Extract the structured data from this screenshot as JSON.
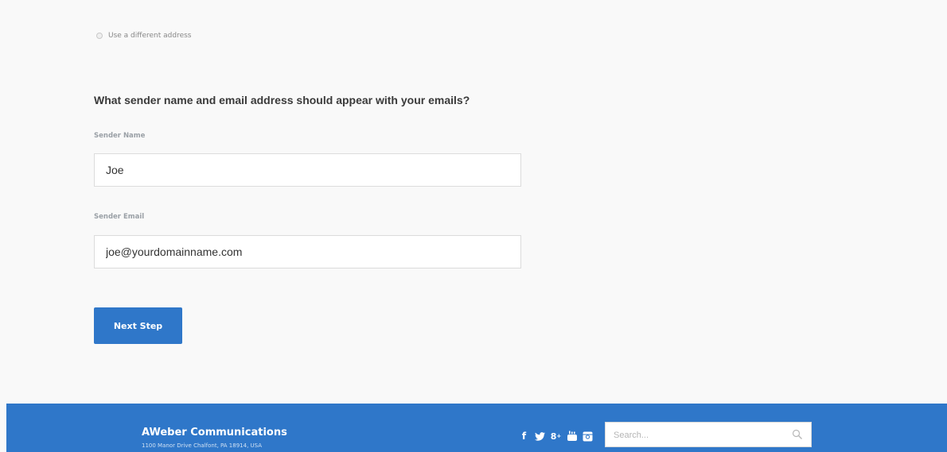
{
  "address_option": {
    "label": "Use a different address",
    "selected": false
  },
  "question": "What sender name and email address should appear with your emails?",
  "sender_name": {
    "label": "Sender Name",
    "value": "Joe"
  },
  "sender_email": {
    "label": "Sender Email",
    "value": "joe@yourdomainname.com"
  },
  "next_button": {
    "label": "Next Step"
  },
  "footer": {
    "company": "AWeber Communications",
    "address": "1100 Manor Drive Chalfont, PA 18914, USA",
    "social_icons": [
      "facebook-icon",
      "twitter-icon",
      "google-plus-icon",
      "youtube-icon",
      "instagram-icon"
    ],
    "search_placeholder": "Search..."
  },
  "colors": {
    "primary": "#2f77c9",
    "background": "#f9f9f9"
  }
}
